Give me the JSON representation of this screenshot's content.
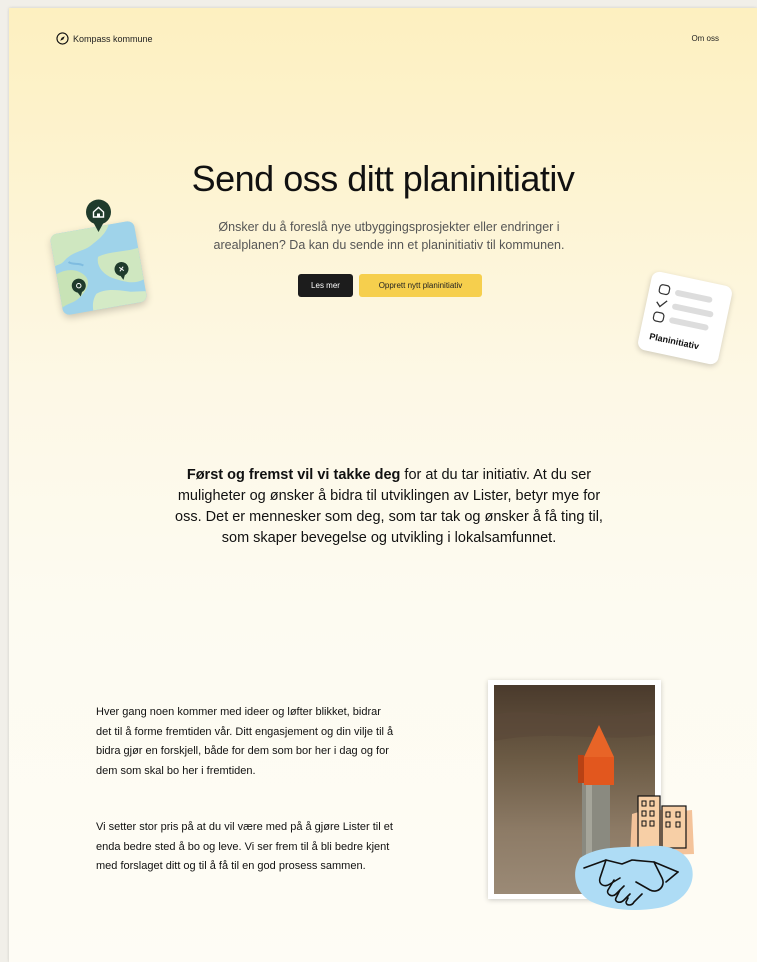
{
  "header": {
    "brand_name": "Kompass kommune",
    "nav_about": "Om oss"
  },
  "hero": {
    "title": "Send oss ditt planinitiativ",
    "subtitle": "Ønsker du å foreslå nye utbyggingsprosjekter eller endringer i arealplanen? Da kan du sende inn et planinitiativ til kommunen.",
    "read_more_label": "Les mer",
    "create_label": "Opprett nytt planinitiativ"
  },
  "checklist_card": {
    "label": "Planinitiativ"
  },
  "statement": {
    "bold": "Først og fremst vil vi takke deg",
    "rest": " for at du tar initiativ. At du ser muligheter og ønsker å bidra til utviklingen av Lister, betyr mye for oss. Det er mennesker som deg, som tar tak og ønsker å få ting til, som skaper bevegelse og utvikling i lokalsamfunnet."
  },
  "body": {
    "paragraph_1": "Hver gang noen kommer med ideer og løfter blikket, bidrar det til å forme fremtiden vår. Ditt engasjement og din vilje til å bidra gjør en forskjell, både for dem som bor her i dag og for dem som skal bo her i fremtiden.",
    "paragraph_2": "Vi setter stor pris på at du vil være med på å gjøre Lister til et enda bedre sted å bo og leve. Vi ser frem til å bli bedre kjent med forslaget ditt og til å få til en god prosess sammen."
  },
  "colors": {
    "accent_yellow": "#f6cf4d",
    "dark_button": "#1c1c1c",
    "pin_green": "#1f3b2c"
  },
  "icons": {
    "brand": "compass-icon",
    "map_pin": "home-pin-icon",
    "checklist": "checklist-icon",
    "handshake": "handshake-icon",
    "buildings": "buildings-icon"
  }
}
